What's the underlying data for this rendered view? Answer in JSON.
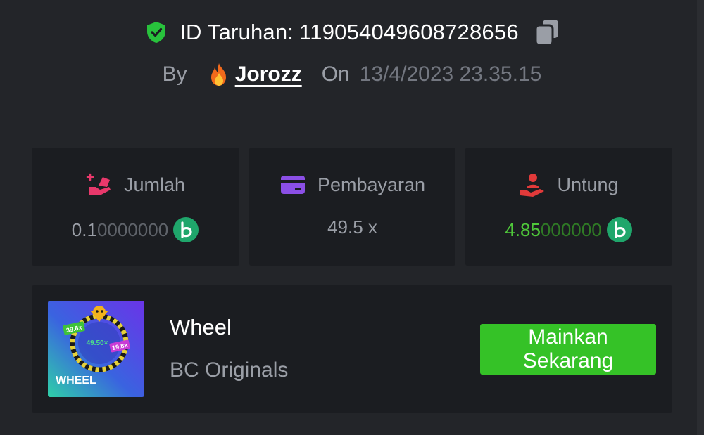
{
  "header": {
    "bet_id_label": "ID Taruhan:",
    "bet_id": "119054049608728656",
    "by_label": "By",
    "username": "Jorozz",
    "on_label": "On",
    "datetime": "13/4/2023 23.35.15"
  },
  "stats": {
    "amount": {
      "label": "Jumlah",
      "value_lit": "0.1",
      "value_dim": "0000000",
      "currency_icon": "bc-coin-icon"
    },
    "payout": {
      "label": "Pembayaran",
      "value": "49.5 x"
    },
    "profit": {
      "label": "Untung",
      "value_lit": "4.85",
      "value_dim": "000000",
      "currency_icon": "bc-coin-icon"
    }
  },
  "game": {
    "name": "Wheel",
    "provider": "BC Originals",
    "play_label": "Mainkan Sekarang",
    "thumb_label": "WHEEL",
    "thumb_chip_left": "39.6x",
    "thumb_center": "49.50×",
    "thumb_chip_right": "19.8x"
  },
  "colors": {
    "background": "#232529",
    "card": "#1b1d21",
    "accent_green": "#35c227",
    "profit_green": "#4fc83a",
    "shield_green": "#28c23c",
    "amount_icon": "#e8386b",
    "payout_icon": "#8b4fe6",
    "profit_icon": "#e23a3a",
    "coin": "#1fa66b"
  }
}
